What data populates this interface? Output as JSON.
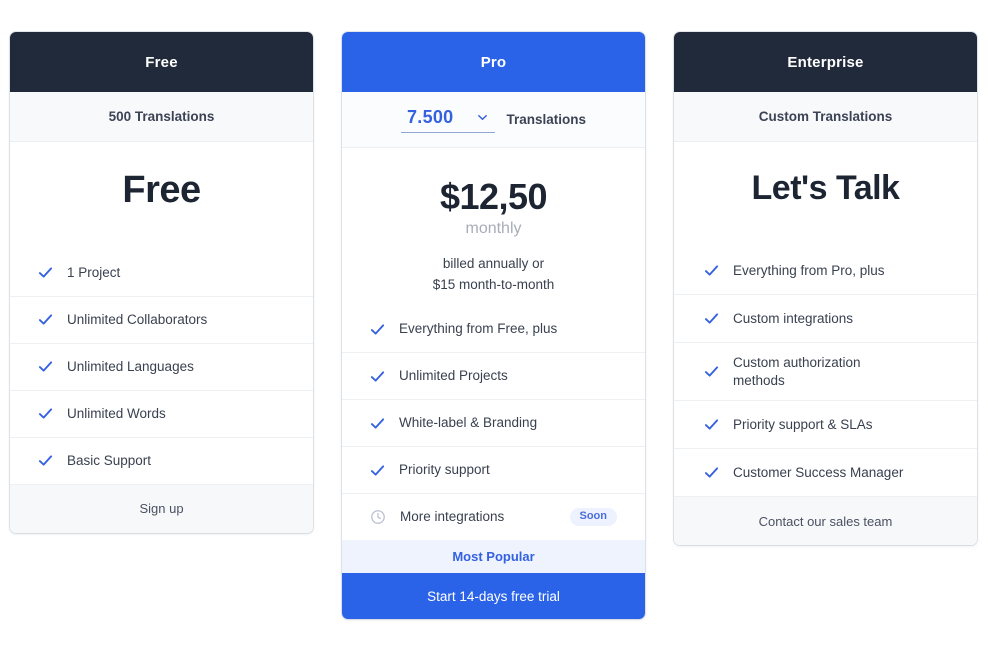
{
  "plans": [
    {
      "name": "Free",
      "header_style": "dark",
      "quota": "500 Translations",
      "hero": "Free",
      "features": [
        {
          "label": "1 Project",
          "icon": "check-icon"
        },
        {
          "label": "Unlimited Collaborators",
          "icon": "check-icon"
        },
        {
          "label": "Unlimited Languages",
          "icon": "check-icon"
        },
        {
          "label": "Unlimited Words",
          "icon": "check-icon"
        },
        {
          "label": "Basic Support",
          "icon": "check-icon"
        }
      ],
      "footer": "Sign up"
    },
    {
      "name": "Pro",
      "header_style": "blue",
      "quota_value": "7.500",
      "quota_unit": "Translations",
      "quota_icon": "chevron-down-icon",
      "price": "$12,50",
      "price_period": "monthly",
      "price_note_line1": "billed annually or",
      "price_note_line2": "$15 month-to-month",
      "features": [
        {
          "label": "Everything from Free, plus",
          "icon": "check-icon"
        },
        {
          "label": "Unlimited Projects",
          "icon": "check-icon"
        },
        {
          "label": "White-label & Branding",
          "icon": "check-icon"
        },
        {
          "label": "Priority support",
          "icon": "check-icon"
        },
        {
          "label": "More integrations",
          "icon": "clock-icon",
          "badge": "Soon"
        }
      ],
      "popular_banner": "Most Popular",
      "cta": "Start 14-days free trial"
    },
    {
      "name": "Enterprise",
      "header_style": "dark",
      "quota": "Custom Translations",
      "hero": "Let's Talk",
      "features": [
        {
          "label": "Everything from Pro, plus",
          "icon": "check-icon"
        },
        {
          "label": "Custom integrations",
          "icon": "check-icon"
        },
        {
          "label": "Custom authorization methods",
          "icon": "check-icon",
          "two_line": true
        },
        {
          "label": "Priority support & SLAs",
          "icon": "check-icon"
        },
        {
          "label": "Customer Success Manager",
          "icon": "check-icon"
        }
      ],
      "footer": "Contact our sales team"
    }
  ],
  "colors": {
    "header_dark": "#212a3a",
    "brand_blue": "#2a63e8",
    "check_blue": "#3461e0",
    "badge_bg": "#eef2fe",
    "popular_bg": "#eef3fe",
    "muted_text": "#a7adb8"
  }
}
